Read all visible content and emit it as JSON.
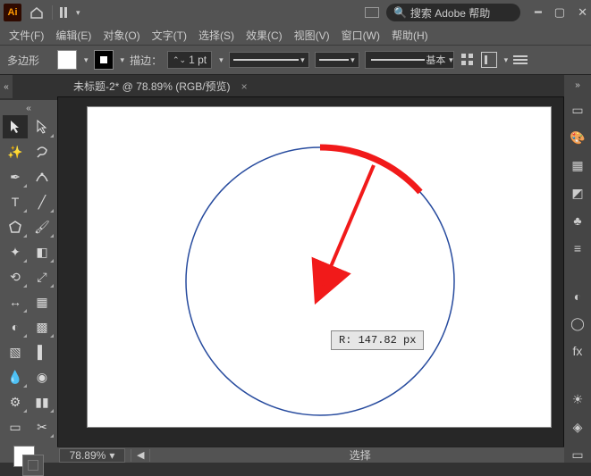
{
  "app": {
    "logo": "Ai",
    "search_placeholder": "搜索 Adobe 帮助"
  },
  "menu": {
    "file": "文件(F)",
    "edit": "编辑(E)",
    "object": "对象(O)",
    "type": "文字(T)",
    "select": "选择(S)",
    "effect": "效果(C)",
    "view": "视图(V)",
    "window": "窗口(W)",
    "help": "帮助(H)"
  },
  "options": {
    "shape": "多边形",
    "stroke_label": "描边：",
    "stroke_pt": "1 pt",
    "profile": "基本"
  },
  "tab": {
    "title": "未标题-2* @ 78.89% (RGB/预览)",
    "close": "×"
  },
  "status": {
    "zoom": "78.89%",
    "selection": "选择"
  },
  "canvas": {
    "radius_label": "R: 147.82 px"
  },
  "colors": {
    "circle": "#274b9e",
    "arc": "#f11a1a",
    "arrow": "#f11a1a"
  }
}
